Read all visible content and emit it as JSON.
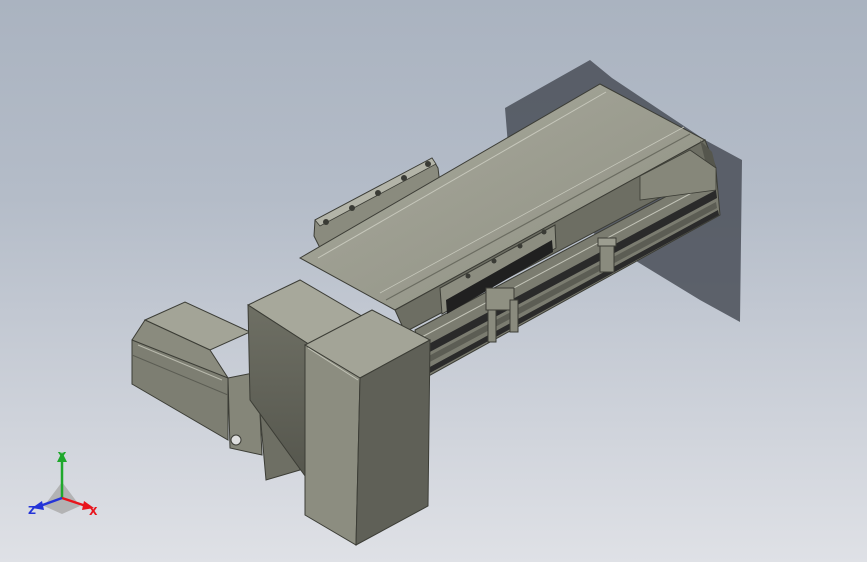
{
  "viewport": {
    "background_top": "#aab3c0",
    "background_bottom": "#dfe1e6"
  },
  "model": {
    "body_color": "#8f9082",
    "shadow_color": "#4a4f58",
    "slot_color": "#2a2a2a"
  },
  "triad": {
    "x_label": "X",
    "y_label": "Y",
    "z_label": "Z",
    "x_color": "#e8141c",
    "y_color": "#1fa82c",
    "z_color": "#2434d8"
  }
}
